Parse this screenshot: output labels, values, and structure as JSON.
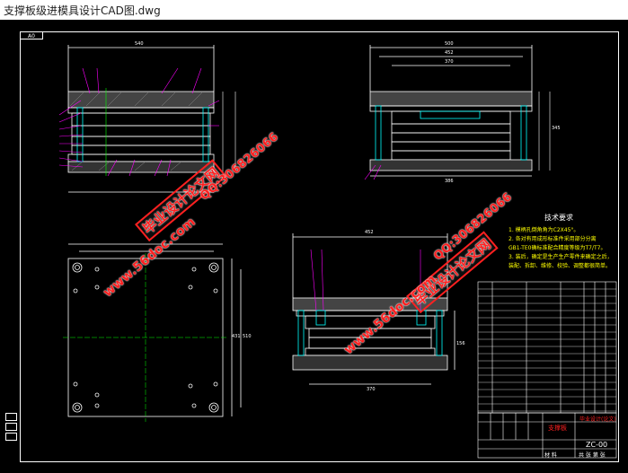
{
  "window": {
    "title": "支撑板级进模具设计CAD图.dwg"
  },
  "drawing": {
    "zone_tag": "A0",
    "dimensions": {
      "top_left_width": "540",
      "top_right_width_outer": "500",
      "top_right_width_mid": "452",
      "top_right_width_inner": "370",
      "top_right_bottom": "386",
      "top_right_height": "345",
      "bottom_right_width": "452",
      "bottom_right_base": "370",
      "bottom_left_height_outer": "510",
      "bottom_left_height_inner": "431",
      "bottom_right_height": "156"
    },
    "tech_requirements": {
      "title": "技术要求",
      "lines": [
        "1. 模柄孔倒角角为C2X45°。",
        "2. 各对有用成形标准件采用部分分离",
        "   GB1-TE0确标准配合精度等级为T7/T7。",
        "3. 装后，确定是生产生产零件来确定之后，",
        "   装配、拆卸、维修、校验、调整都很简单。"
      ]
    },
    "title_block": {
      "part_name": "支撑板",
      "drawing_no": "ZC-00",
      "school_label": "毕业设计(论文)",
      "bottom_left": "材 料",
      "bottom_mid": "共 张 第 张"
    }
  },
  "watermarks": [
    {
      "text": "毕业设计论文网",
      "style": "box"
    },
    {
      "text": "QQ:306826066",
      "style": "red"
    },
    {
      "text": "www.56doc.com",
      "style": "red"
    },
    {
      "text": "毕业设计论文网",
      "style": "box"
    },
    {
      "text": "QQ:306826066",
      "style": "red"
    },
    {
      "text": "www.56doc.com",
      "style": "red"
    }
  ],
  "colors": {
    "background": "#000000",
    "lines": "#ffffff",
    "magenta": "#ff00ff",
    "red": "#ff2020",
    "yellow": "#ffff00",
    "cyan": "#00ffff",
    "green": "#00ff00"
  }
}
